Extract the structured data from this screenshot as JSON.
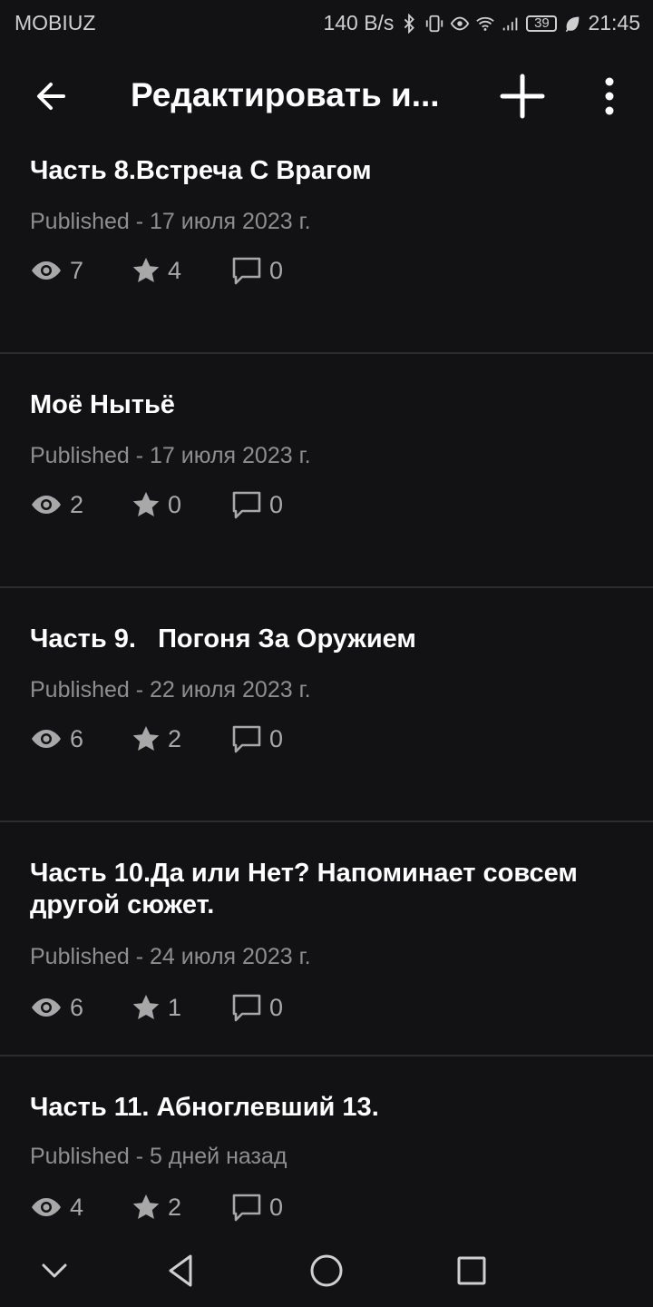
{
  "status_bar": {
    "carrier": "MOBIUZ",
    "net_speed": "140 B/s",
    "battery": "39",
    "time": "21:45"
  },
  "app_bar": {
    "title": "Редактировать и...",
    "back_icon": "arrow-left-icon",
    "add_icon": "plus-icon",
    "more_icon": "more-vertical-icon"
  },
  "parts": [
    {
      "title": "Часть 8.Встреча С Врагом",
      "status": "Published - 17 июля 2023 г.",
      "views": "7",
      "votes": "4",
      "comments": "0"
    },
    {
      "title": "Моё Нытьё",
      "status": "Published - 17 июля 2023 г.",
      "views": "2",
      "votes": "0",
      "comments": "0"
    },
    {
      "title": "Часть 9.   Погоня За Оружием",
      "status": "Published - 22 июля 2023 г.",
      "views": "6",
      "votes": "2",
      "comments": "0"
    },
    {
      "title": "Часть 10.Да или Нет? Напоминает совсем другой сюжет.",
      "status": "Published - 24 июля 2023 г.",
      "views": "6",
      "votes": "1",
      "comments": "0"
    },
    {
      "title": "Часть 11. Абноглевший 13.",
      "status": "Published - 5 дней назад",
      "views": "4",
      "votes": "2",
      "comments": "0"
    }
  ],
  "colors": {
    "background": "#121114",
    "divider": "#2c2b2e",
    "meta_text": "#8e8e8e"
  }
}
